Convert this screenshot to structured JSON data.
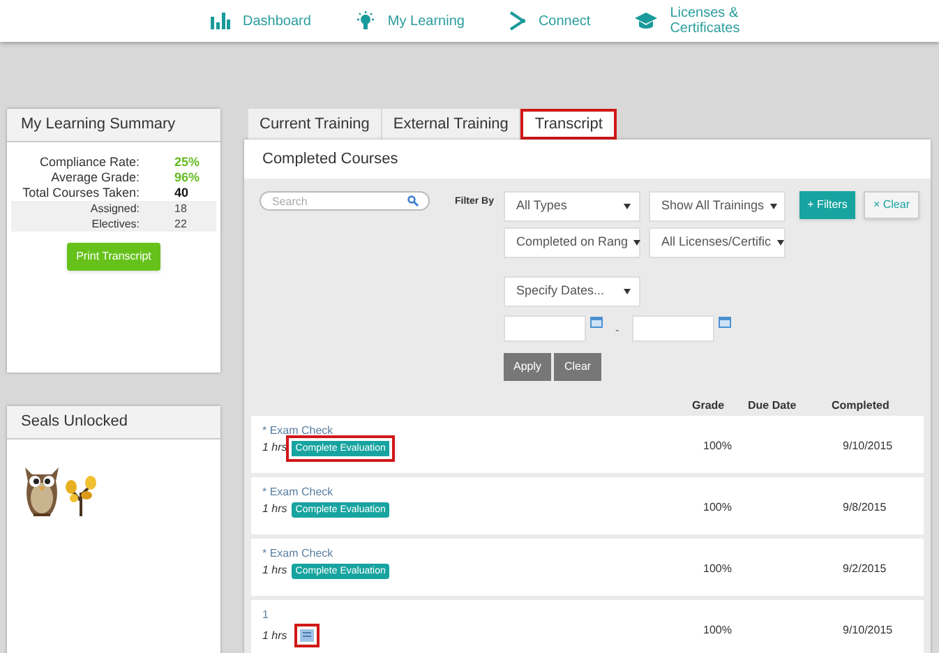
{
  "nav": [
    {
      "label": "Dashboard",
      "kind": "chart"
    },
    {
      "label": "My Learning",
      "kind": "bulb"
    },
    {
      "label": "Connect",
      "kind": "connect"
    },
    {
      "label": "Licenses & Certificates",
      "kind": "cap"
    }
  ],
  "summary": {
    "title": "My Learning Summary",
    "stats": [
      {
        "label": "Compliance Rate:",
        "value": "25%",
        "kind": "rate"
      },
      {
        "label": "Average Grade:",
        "value": "96%",
        "kind": "rate"
      },
      {
        "label": "Total Courses Taken:",
        "value": "40",
        "kind": "total"
      },
      {
        "label": "Assigned:",
        "value": "18",
        "kind": "sub"
      },
      {
        "label": "Electives:",
        "value": "22",
        "kind": "sub"
      }
    ],
    "button": "Print Transcript"
  },
  "seals": {
    "title": "Seals Unlocked",
    "items": [
      {
        "kind": "owl"
      },
      {
        "kind": "sprout"
      }
    ]
  },
  "tabs": [
    {
      "label": "Current Training",
      "selected": false,
      "highlighted": false
    },
    {
      "label": "External Training",
      "selected": false,
      "highlighted": false
    },
    {
      "label": "Transcript",
      "selected": true,
      "highlighted": true
    }
  ],
  "section_title": "Completed Courses",
  "search": {
    "placeholder": "Search"
  },
  "filter_label": "Filter By",
  "selects": [
    [
      "All Types",
      "Show All Trainings"
    ],
    [
      "Completed on Rang",
      "All Licenses/Certific"
    ],
    [
      "Specify Dates..."
    ]
  ],
  "filters_button": "+ Filters",
  "clear_filters_button": "× Clear",
  "date_separator": "-",
  "apply_button": "Apply",
  "clear_button": "Clear",
  "columns": [
    "Grade",
    "Due Date",
    "Completed"
  ],
  "rows": [
    {
      "title": "* Exam Check",
      "hours": "1 hrs",
      "action": {
        "kind": "button",
        "label": "Complete Evaluation",
        "highlighted": true
      },
      "grade": "100%",
      "completed": "9/10/2015"
    },
    {
      "title": "* Exam Check",
      "hours": "1 hrs",
      "action": {
        "kind": "button",
        "label": "Complete Evaluation",
        "highlighted": false
      },
      "grade": "100%",
      "completed": "9/8/2015"
    },
    {
      "title": "* Exam Check",
      "hours": "1 hrs",
      "action": {
        "kind": "button",
        "label": "Complete Evaluation",
        "highlighted": false
      },
      "grade": "100%",
      "completed": "9/2/2015"
    },
    {
      "title": "1",
      "hours": "1 hrs",
      "action": {
        "kind": "icon",
        "highlighted": true
      },
      "grade": "100%",
      "completed": "9/10/2015"
    }
  ]
}
